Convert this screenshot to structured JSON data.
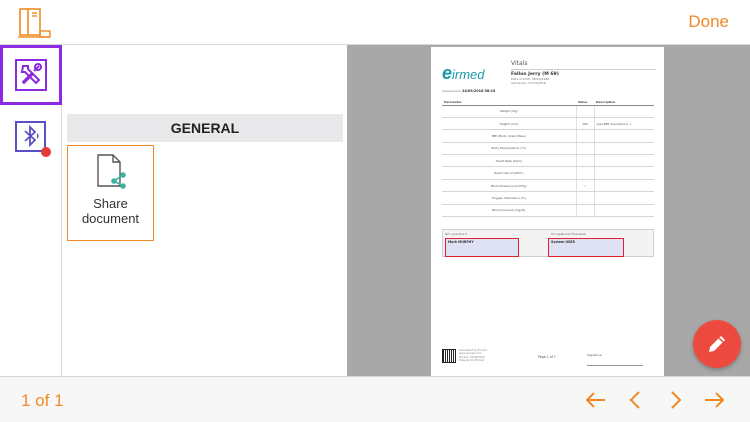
{
  "toolbar": {
    "done_label": "Done",
    "book_icon": "bookshelf-icon",
    "accent_color": "#f08a24"
  },
  "rail": {
    "tools_icon": "hammer-wrench-icon",
    "tools_selected_color": "#8a2be2",
    "bluetooth_icon": "bluetooth-icon",
    "bluetooth_badge_color": "#e53935"
  },
  "panel": {
    "section_title": "GENERAL",
    "share": {
      "icon": "share-document-icon",
      "label_line1": "Share",
      "label_line2": "document"
    }
  },
  "document": {
    "logo_text": "eirmed",
    "title": "Vitals",
    "patient": "Fallon Jerry (M 69)",
    "meta_line1": "Date of birth: 08/09/1980",
    "meta_line2": "Admission: 07/03/2018",
    "assessment_label": "Assessment",
    "assessment_value": "24/09/2018 08:15",
    "columns": {
      "parameter": "Parameter",
      "value": "Value",
      "description": "Description"
    },
    "rows": [
      {
        "parameter": "Weight (Kg)",
        "value": "",
        "description": ""
      },
      {
        "parameter": "Height (Cm)",
        "value": "180",
        "description": "(see BMI description) ↓"
      },
      {
        "parameter": "BMI (Body Index Mass)",
        "value": "",
        "description": ""
      },
      {
        "parameter": "Body Temperature (°C)",
        "value": "",
        "description": ""
      },
      {
        "parameter": "Heart Rate (bpm)",
        "value": "",
        "description": ""
      },
      {
        "parameter": "Heart rate (rhythm)",
        "value": "",
        "description": ""
      },
      {
        "parameter": "Blood Pressure (mmHg)",
        "value": "/",
        "description": ""
      },
      {
        "parameter": "Oxygen Saturation (%)",
        "value": "",
        "description": ""
      },
      {
        "parameter": "Blood Glucose (mg/dl)",
        "value": "",
        "description": ""
      }
    ],
    "sign_left_label": "GP / practice E",
    "sign_left_name": "Mark MURPHY",
    "sign_right_label": "Occupational Therapist",
    "sign_right_name": "System USER",
    "footer_text_line1": "Generated by Eirmed",
    "footer_text_line2": "www.eirmed.com",
    "footer_text_line3": "Printed: 24/09/2018",
    "footer_text_line4": "Powered by Eirmed",
    "page_label": "Page 1 of 1",
    "signature_label": "Signature"
  },
  "fab": {
    "icon": "pencil-icon",
    "color": "#ec4a3f"
  },
  "footer": {
    "page_count": "1 of 1",
    "first_icon": "arrow-left-icon",
    "prev_icon": "chevron-left-icon",
    "next_icon": "chevron-right-icon",
    "last_icon": "arrow-right-icon"
  }
}
